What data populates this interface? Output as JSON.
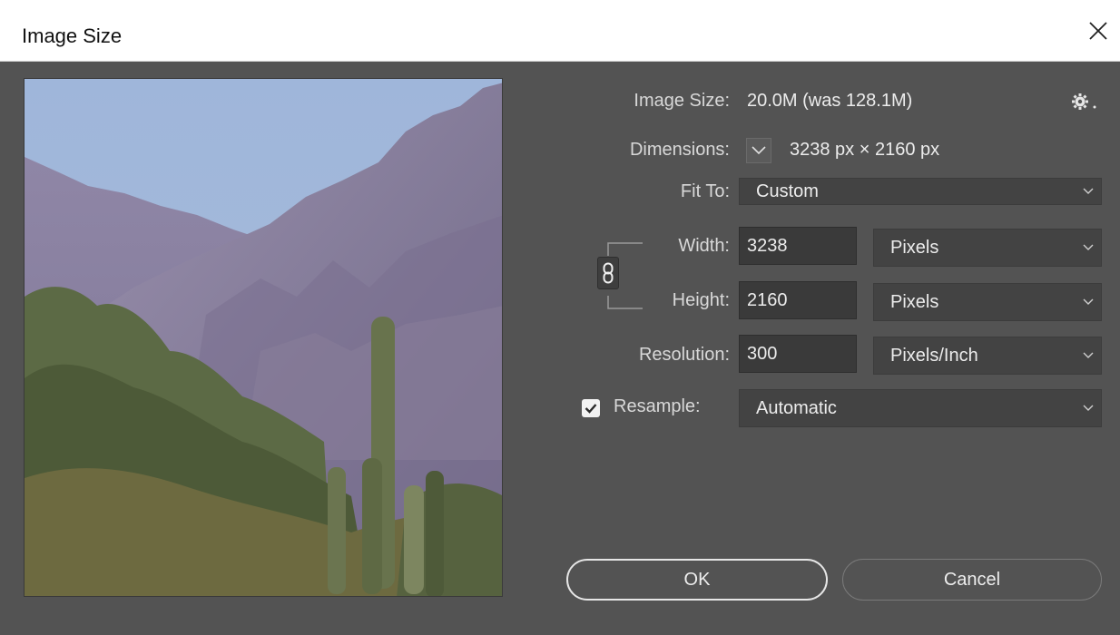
{
  "window": {
    "title": "Image Size"
  },
  "info": {
    "image_size_label": "Image Size:",
    "image_size_value": "20.0M (was 128.1M)",
    "dimensions_label": "Dimensions:",
    "dimensions_value": "3238 px  ×  2160 px"
  },
  "fit_to": {
    "label": "Fit To:",
    "value": "Custom"
  },
  "width": {
    "label": "Width:",
    "value": "3238",
    "unit": "Pixels"
  },
  "height": {
    "label": "Height:",
    "value": "2160",
    "unit": "Pixels"
  },
  "resolution": {
    "label": "Resolution:",
    "value": "300",
    "unit": "Pixels/Inch"
  },
  "resample": {
    "label": "Resample:",
    "checked": true,
    "value": "Automatic"
  },
  "buttons": {
    "ok": "OK",
    "cancel": "Cancel"
  },
  "icons": [
    "close-icon",
    "gear-icon",
    "chevron-down-icon",
    "link-chain-icon",
    "checkmark-icon"
  ]
}
